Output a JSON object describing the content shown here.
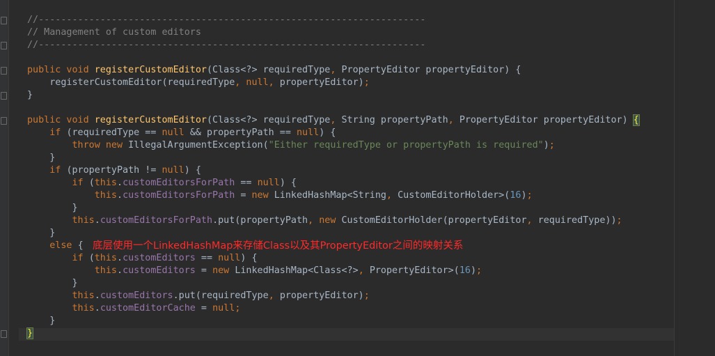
{
  "code": {
    "lines": [
      [
        {
          "t": "//---------------------------------------------------------------------",
          "c": "c"
        }
      ],
      [
        {
          "t": "// Management of custom editors",
          "c": "c"
        }
      ],
      [
        {
          "t": "//---------------------------------------------------------------------",
          "c": "c"
        }
      ],
      [],
      [
        {
          "t": "public void ",
          "c": "k"
        },
        {
          "t": "registerCustomEditor",
          "c": "f"
        },
        {
          "t": "(Class<?> requiredType"
        },
        {
          "t": ", ",
          "c": "p"
        },
        {
          "t": "PropertyEditor propertyEditor) {"
        }
      ],
      [
        {
          "t": "    registerCustomEditor(requiredType"
        },
        {
          "t": ", ",
          "c": "p"
        },
        {
          "t": "null",
          "c": "k"
        },
        {
          "t": ", ",
          "c": "p"
        },
        {
          "t": "propertyEditor)"
        },
        {
          "t": ";",
          "c": "p"
        }
      ],
      [
        {
          "t": "}"
        }
      ],
      [],
      [
        {
          "t": "public void ",
          "c": "k"
        },
        {
          "t": "registerCustomEditor",
          "c": "f"
        },
        {
          "t": "(Class<?> requiredType"
        },
        {
          "t": ", ",
          "c": "p"
        },
        {
          "t": "String propertyPath"
        },
        {
          "t": ", ",
          "c": "p"
        },
        {
          "t": "PropertyEditor propertyEditor) "
        },
        {
          "t": "{",
          "c": "brace-hl"
        }
      ],
      [
        {
          "t": "    "
        },
        {
          "t": "if ",
          "c": "k"
        },
        {
          "t": "(requiredType == "
        },
        {
          "t": "null ",
          "c": "k"
        },
        {
          "t": "&& propertyPath == "
        },
        {
          "t": "null",
          "c": "k"
        },
        {
          "t": ") {"
        }
      ],
      [
        {
          "t": "        "
        },
        {
          "t": "throw new ",
          "c": "k"
        },
        {
          "t": "IllegalArgumentException("
        },
        {
          "t": "\"Either requiredType or propertyPath is required\"",
          "c": "s"
        },
        {
          "t": ")"
        },
        {
          "t": ";",
          "c": "p"
        }
      ],
      [
        {
          "t": "    }"
        }
      ],
      [
        {
          "t": "    "
        },
        {
          "t": "if ",
          "c": "k"
        },
        {
          "t": "(propertyPath != "
        },
        {
          "t": "null",
          "c": "k"
        },
        {
          "t": ") {"
        }
      ],
      [
        {
          "t": "        "
        },
        {
          "t": "if ",
          "c": "k"
        },
        {
          "t": "("
        },
        {
          "t": "this",
          "c": "k"
        },
        {
          "t": "."
        },
        {
          "t": "customEditorsForPath",
          "c": "fld"
        },
        {
          "t": " == "
        },
        {
          "t": "null",
          "c": "k"
        },
        {
          "t": ") {"
        }
      ],
      [
        {
          "t": "            "
        },
        {
          "t": "this",
          "c": "k"
        },
        {
          "t": "."
        },
        {
          "t": "customEditorsForPath",
          "c": "fld"
        },
        {
          "t": " = "
        },
        {
          "t": "new ",
          "c": "k"
        },
        {
          "t": "LinkedHashMap<String"
        },
        {
          "t": ", ",
          "c": "p"
        },
        {
          "t": "CustomEditorHolder>("
        },
        {
          "t": "16",
          "c": "n"
        },
        {
          "t": ")"
        },
        {
          "t": ";",
          "c": "p"
        }
      ],
      [
        {
          "t": "        }"
        }
      ],
      [
        {
          "t": "        "
        },
        {
          "t": "this",
          "c": "k"
        },
        {
          "t": "."
        },
        {
          "t": "customEditorsForPath",
          "c": "fld"
        },
        {
          "t": ".put(propertyPath"
        },
        {
          "t": ", ",
          "c": "p"
        },
        {
          "t": "new ",
          "c": "k"
        },
        {
          "t": "CustomEditorHolder(propertyEditor"
        },
        {
          "t": ", ",
          "c": "p"
        },
        {
          "t": "requiredType))"
        },
        {
          "t": ";",
          "c": "p"
        }
      ],
      [
        {
          "t": "    }"
        }
      ],
      [
        {
          "t": "    "
        },
        {
          "t": "else ",
          "c": "k"
        },
        {
          "t": "{"
        }
      ],
      [
        {
          "t": "        "
        },
        {
          "t": "if ",
          "c": "k"
        },
        {
          "t": "("
        },
        {
          "t": "this",
          "c": "k"
        },
        {
          "t": "."
        },
        {
          "t": "customEditors",
          "c": "fld"
        },
        {
          "t": " == "
        },
        {
          "t": "null",
          "c": "k"
        },
        {
          "t": ") {"
        }
      ],
      [
        {
          "t": "            "
        },
        {
          "t": "this",
          "c": "k"
        },
        {
          "t": "."
        },
        {
          "t": "customEditors",
          "c": "fld"
        },
        {
          "t": " = "
        },
        {
          "t": "new ",
          "c": "k"
        },
        {
          "t": "LinkedHashMap<Class<?>"
        },
        {
          "t": ", ",
          "c": "p"
        },
        {
          "t": "PropertyEditor>("
        },
        {
          "t": "16",
          "c": "n"
        },
        {
          "t": ")"
        },
        {
          "t": ";",
          "c": "p"
        }
      ],
      [
        {
          "t": "        }"
        }
      ],
      [
        {
          "t": "        "
        },
        {
          "t": "this",
          "c": "k"
        },
        {
          "t": "."
        },
        {
          "t": "customEditors",
          "c": "fld"
        },
        {
          "t": ".put(requiredType"
        },
        {
          "t": ", ",
          "c": "p"
        },
        {
          "t": "propertyEditor)"
        },
        {
          "t": ";",
          "c": "p"
        }
      ],
      [
        {
          "t": "        "
        },
        {
          "t": "this",
          "c": "k"
        },
        {
          "t": "."
        },
        {
          "t": "customEditorCache",
          "c": "fld"
        },
        {
          "t": " = "
        },
        {
          "t": "null",
          "c": "k"
        },
        {
          "t": ";",
          "c": "p"
        }
      ],
      [
        {
          "t": "    }"
        }
      ],
      [
        {
          "t": "}",
          "c": "brace-hl"
        }
      ]
    ]
  },
  "annotation": {
    "text": "底层使用一个LinkedHashMap来存储Class以及其PropertyEditor之间的映射关系"
  },
  "colors": {
    "background": "#2b2b2b",
    "keyword": "#cc7832",
    "method": "#ffc66d",
    "comment": "#808080",
    "string": "#6a8759",
    "number": "#6897bb",
    "field": "#9876aa",
    "annotation": "#ff2a2a"
  }
}
